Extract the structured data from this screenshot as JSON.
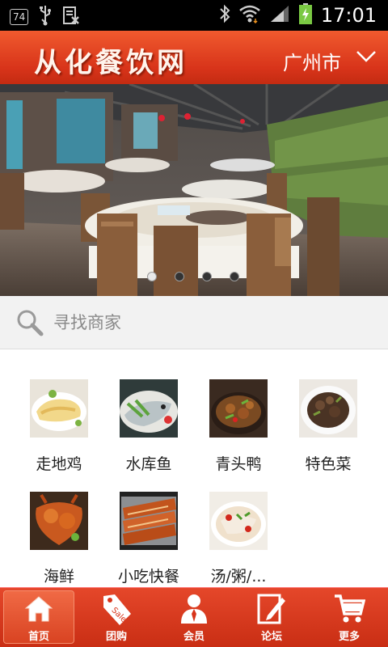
{
  "status_bar": {
    "badge": "74",
    "time": "17:01"
  },
  "header": {
    "site_title": "从化餐饮网",
    "city": "广州市"
  },
  "banner": {
    "slide_count": 4,
    "active_slide": 1
  },
  "search": {
    "placeholder": "寻找商家"
  },
  "categories": [
    {
      "label": "走地鸡"
    },
    {
      "label": "水库鱼"
    },
    {
      "label": "青头鸭"
    },
    {
      "label": "特色菜"
    },
    {
      "label": "海鲜"
    },
    {
      "label": "小吃快餐"
    },
    {
      "label": "汤/粥/..."
    }
  ],
  "tabs": [
    {
      "label": "首页",
      "icon": "home-icon",
      "active": true
    },
    {
      "label": "团购",
      "icon": "sale-tag-icon",
      "active": false
    },
    {
      "label": "会员",
      "icon": "member-icon",
      "active": false
    },
    {
      "label": "论坛",
      "icon": "forum-edit-icon",
      "active": false
    },
    {
      "label": "更多",
      "icon": "cart-icon",
      "active": false
    }
  ],
  "colors": {
    "header": "#d8341a",
    "tabbar": "#c92e14"
  }
}
